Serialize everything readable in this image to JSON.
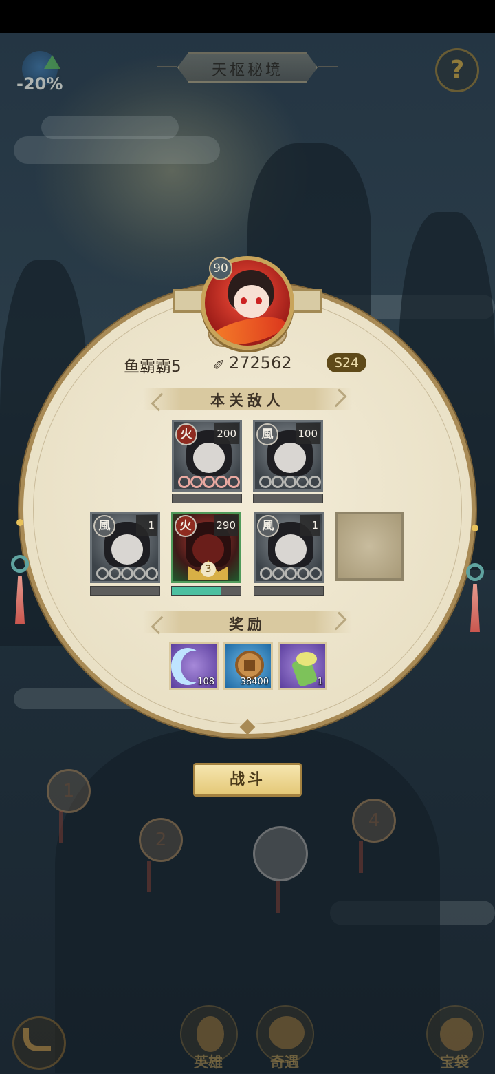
{
  "header": {
    "buff_label": "-20%",
    "title": "天枢秘境",
    "help_label": "?"
  },
  "player": {
    "level": "90",
    "name": "鱼霸霸5",
    "power": "272562",
    "server": "S24"
  },
  "enemies": {
    "section_title": "本关敌人",
    "units": [
      {
        "element": "火",
        "level": "200",
        "stars": 5,
        "hp": 0
      },
      {
        "element": "風",
        "level": "100",
        "stars": 5,
        "hp": 0
      },
      {
        "element": "風",
        "level": "1",
        "stars": 5,
        "hp": 0
      },
      {
        "element": "火",
        "level": "290",
        "rank": "3",
        "hp": 0.8
      },
      {
        "element": "風",
        "level": "1",
        "stars": 5,
        "hp": 0
      }
    ]
  },
  "rewards": {
    "section_title": "奖励",
    "items": [
      {
        "icon": "moon-shard-icon",
        "count": "108"
      },
      {
        "icon": "copper-coin-icon",
        "count": "38400"
      },
      {
        "icon": "bamboo-tube-icon",
        "count": "1"
      }
    ]
  },
  "fight_label": "战斗",
  "stage_nodes": [
    "1",
    "2",
    "4"
  ],
  "nav": {
    "hero_label": "英雄",
    "encounter_label": "奇遇",
    "bag_label": "宝袋"
  },
  "colors": {
    "panel": "#efe7cf",
    "panel_border": "#a88a55",
    "hp_fill": "#4cbfa0",
    "fight_button": "#f0dc9a"
  }
}
